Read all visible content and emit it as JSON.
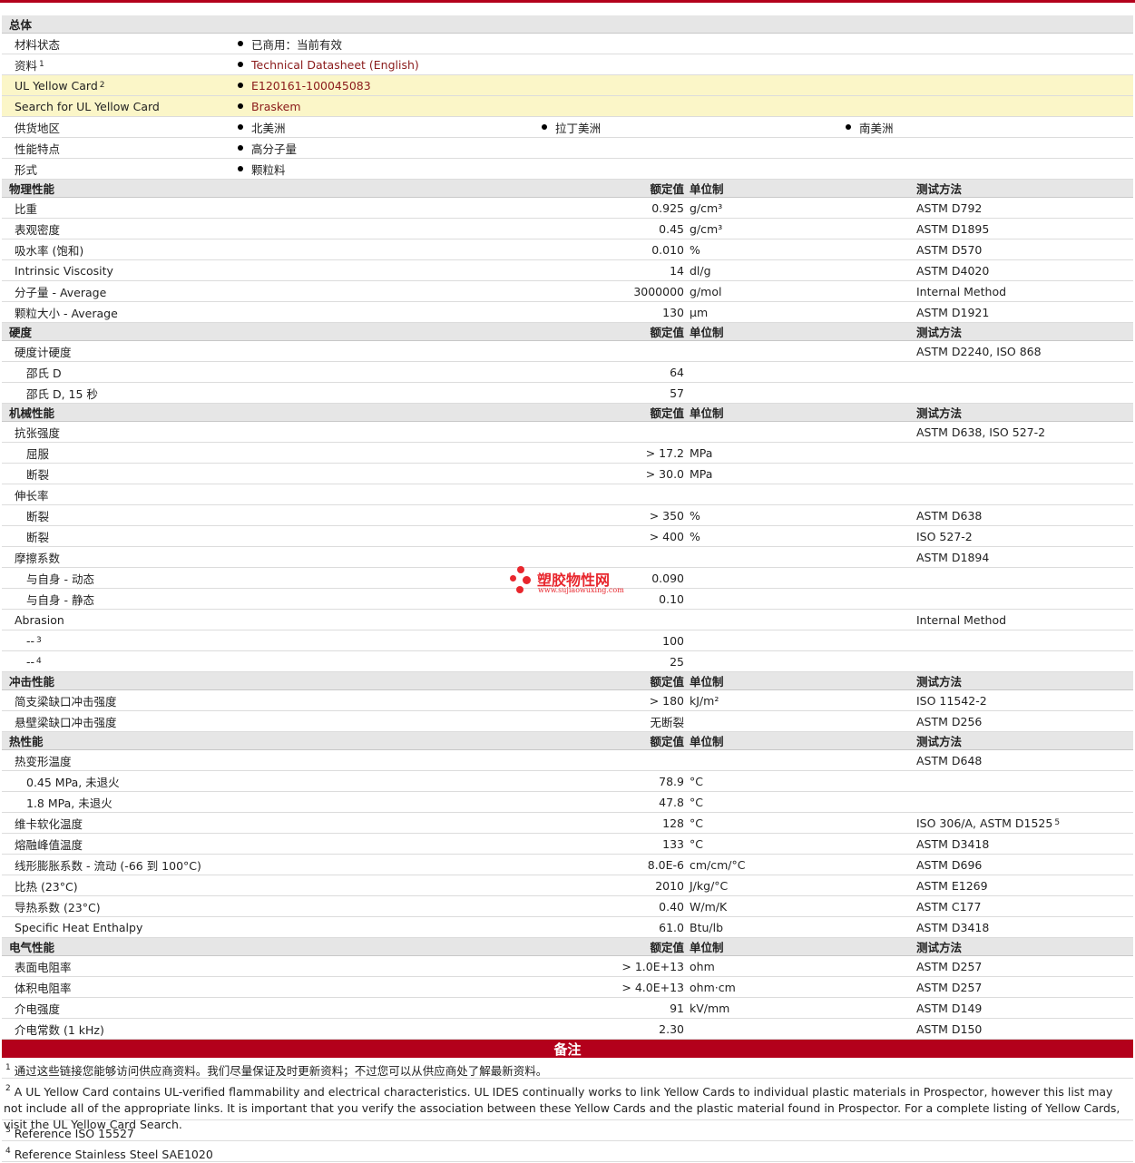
{
  "general": {
    "title": "总体",
    "rows": [
      {
        "label": "材料状态",
        "items": [
          "已商用：当前有效"
        ]
      },
      {
        "label": "资料",
        "sup": "1",
        "items": [
          "Technical Datasheet (English)"
        ],
        "link": true
      },
      {
        "label": "UL Yellow Card",
        "sup": "2",
        "items": [
          "E120161-100045083"
        ],
        "link": true,
        "yellow": true
      },
      {
        "label": "Search for UL Yellow Card",
        "items": [
          "Braskem"
        ],
        "link": true,
        "yellow": true
      },
      {
        "label": "供货地区",
        "items": [
          "北美洲",
          "拉丁美洲",
          "南美洲"
        ]
      },
      {
        "label": "性能特点",
        "items": [
          "高分子量"
        ]
      },
      {
        "label": "形式",
        "items": [
          "颗粒料"
        ]
      }
    ]
  },
  "headers": {
    "value": "额定值",
    "unit": "单位制",
    "method": "测试方法"
  },
  "sections": [
    {
      "title": "物理性能",
      "rows": [
        {
          "label": "比重",
          "value": "0.925",
          "unit": "g/cm³",
          "method": "ASTM D792"
        },
        {
          "label": "表观密度",
          "value": "0.45",
          "unit": "g/cm³",
          "method": "ASTM D1895"
        },
        {
          "label": "吸水率 (饱和)",
          "value": "0.010",
          "unit": "%",
          "method": "ASTM D570"
        },
        {
          "label": "Intrinsic Viscosity",
          "value": "14",
          "unit": "dl/g",
          "method": "ASTM D4020"
        },
        {
          "label": "分子量  - Average",
          "value": "3000000",
          "unit": "g/mol",
          "method": "Internal Method"
        },
        {
          "label": "颗粒大小  - Average",
          "value": "130",
          "unit": "µm",
          "method": "ASTM D1921"
        }
      ]
    },
    {
      "title": "硬度",
      "rows": [
        {
          "label": "硬度计硬度",
          "value": "",
          "unit": "",
          "method": "ASTM D2240, ISO 868"
        },
        {
          "label": "邵氏 D",
          "value": "64",
          "unit": "",
          "method": "",
          "indent": true
        },
        {
          "label": "邵氏 D, 15 秒",
          "value": "57",
          "unit": "",
          "method": "",
          "indent": true
        }
      ]
    },
    {
      "title": "机械性能",
      "rows": [
        {
          "label": "抗张强度",
          "value": "",
          "unit": "",
          "method": "ASTM D638, ISO 527-2"
        },
        {
          "label": "屈服",
          "value": "> 17.2",
          "unit": "MPa",
          "method": "",
          "indent": true
        },
        {
          "label": "断裂",
          "value": "> 30.0",
          "unit": "MPa",
          "method": "",
          "indent": true
        },
        {
          "label": "伸长率",
          "value": "",
          "unit": "",
          "method": ""
        },
        {
          "label": "断裂",
          "value": "> 350",
          "unit": "%",
          "method": "ASTM D638",
          "indent": true
        },
        {
          "label": "断裂",
          "value": "> 400",
          "unit": "%",
          "method": "ISO 527-2",
          "indent": true
        },
        {
          "label": "摩擦系数",
          "value": "",
          "unit": "",
          "method": "ASTM D1894"
        },
        {
          "label": "与自身  - 动态",
          "value": "0.090",
          "unit": "",
          "method": "",
          "indent": true
        },
        {
          "label": "与自身  - 静态",
          "value": "0.10",
          "unit": "",
          "method": "",
          "indent": true
        },
        {
          "label": "Abrasion",
          "value": "",
          "unit": "",
          "method": "Internal Method"
        },
        {
          "label": "--",
          "sup": "3",
          "value": "100",
          "unit": "",
          "method": "",
          "indent": true
        },
        {
          "label": "--",
          "sup": "4",
          "value": "25",
          "unit": "",
          "method": "",
          "indent": true
        }
      ]
    },
    {
      "title": "冲击性能",
      "rows": [
        {
          "label": "简支梁缺口冲击强度",
          "value": "> 180",
          "unit": "kJ/m²",
          "method": "ISO 11542-2"
        },
        {
          "label": "悬壁梁缺口冲击强度",
          "value": "无断裂",
          "unit": "",
          "method": "ASTM D256"
        }
      ]
    },
    {
      "title": "热性能",
      "rows": [
        {
          "label": "热变形温度",
          "value": "",
          "unit": "",
          "method": "ASTM D648"
        },
        {
          "label": "0.45 MPa, 未退火",
          "value": "78.9",
          "unit": "°C",
          "method": "",
          "indent": true
        },
        {
          "label": "1.8 MPa, 未退火",
          "value": "47.8",
          "unit": "°C",
          "method": "",
          "indent": true
        },
        {
          "label": "维卡软化温度",
          "value": "128",
          "unit": "°C",
          "method": "ISO 306/A, ASTM D1525",
          "methodSup": "5"
        },
        {
          "label": "熔融峰值温度",
          "value": "133",
          "unit": "°C",
          "method": "ASTM D3418"
        },
        {
          "label": "线形膨胀系数  - 流动 (-66 到  100°C)",
          "value": "8.0E-6",
          "unit": "cm/cm/°C",
          "method": "ASTM D696"
        },
        {
          "label": "比热 (23°C)",
          "value": "2010",
          "unit": "J/kg/°C",
          "method": "ASTM E1269"
        },
        {
          "label": "导热系数 (23°C)",
          "value": "0.40",
          "unit": "W/m/K",
          "method": "ASTM C177"
        },
        {
          "label": "Specific Heat Enthalpy",
          "value": "61.0",
          "unit": "Btu/lb",
          "method": "ASTM D3418"
        }
      ]
    },
    {
      "title": "电气性能",
      "rows": [
        {
          "label": "表面电阻率",
          "value": "> 1.0E+13",
          "unit": "ohm",
          "method": "ASTM D257"
        },
        {
          "label": "体积电阻率",
          "value": "> 4.0E+13",
          "unit": "ohm·cm",
          "method": "ASTM D257"
        },
        {
          "label": "介电强度",
          "value": "91",
          "unit": "kV/mm",
          "method": "ASTM D149"
        },
        {
          "label": "介电常数 (1 kHz)",
          "value": "2.30",
          "unit": "",
          "method": "ASTM D150"
        }
      ]
    }
  ],
  "notes": {
    "title": "备注",
    "items": [
      {
        "num": "1",
        "text": "通过这些链接您能够访问供应商资料。我们尽量保证及时更新资料；不过您可以从供应商处了解最新资料。"
      },
      {
        "num": "2",
        "text": "A UL Yellow Card contains UL-verified flammability and electrical characteristics. UL IDES continually works to link Yellow Cards to individual plastic materials in Prospector, however this list may not include all of the appropriate links. It is important that you verify the association between these Yellow Cards and the plastic material found in Prospector. For a complete listing of Yellow Cards, visit the UL Yellow Card Search."
      },
      {
        "num": "3",
        "text": "Reference ISO 15527"
      },
      {
        "num": "4",
        "text": "Reference Stainless Steel SAE1020"
      }
    ]
  },
  "watermark": {
    "name": "塑胶物性网",
    "url": "www.sujiaowuxing.com"
  }
}
